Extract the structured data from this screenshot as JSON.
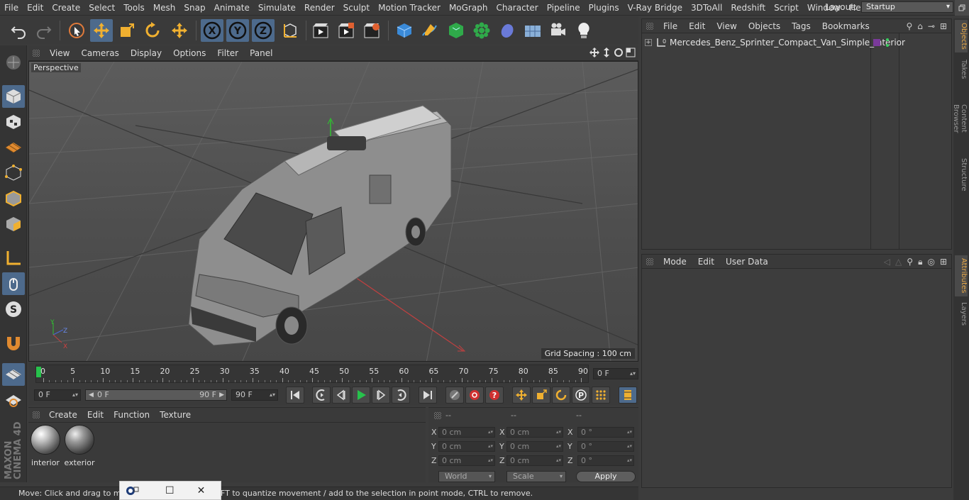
{
  "menubar": {
    "items": [
      "File",
      "Edit",
      "Create",
      "Select",
      "Tools",
      "Mesh",
      "Snap",
      "Animate",
      "Simulate",
      "Render",
      "Sculpt",
      "Motion Tracker",
      "MoGraph",
      "Character",
      "Pipeline",
      "Plugins",
      "V-Ray Bridge",
      "3DToAll",
      "Redshift",
      "Script",
      "Window",
      "Help"
    ],
    "layout_label": "Layout:",
    "layout_value": "Startup"
  },
  "viewport": {
    "menu": [
      "View",
      "Cameras",
      "Display",
      "Options",
      "Filter",
      "Panel"
    ],
    "label": "Perspective",
    "grid_spacing": "Grid Spacing : 100 cm"
  },
  "timeline": {
    "ticks": [
      "0",
      "5",
      "10",
      "15",
      "20",
      "25",
      "30",
      "35",
      "40",
      "45",
      "50",
      "55",
      "60",
      "65",
      "70",
      "75",
      "80",
      "85",
      "90"
    ],
    "current_frame": "0 F"
  },
  "anim": {
    "start": "0 F",
    "range_start": "0 F",
    "range_end": "90 F",
    "end": "90 F"
  },
  "materials": {
    "menu": [
      "Create",
      "Edit",
      "Function",
      "Texture"
    ],
    "items": [
      {
        "name": "interior"
      },
      {
        "name": "exterior"
      }
    ]
  },
  "coords": {
    "headers": [
      "--",
      "--",
      "--"
    ],
    "rows": [
      {
        "axis": "X",
        "pos": "0 cm",
        "size_axis": "X",
        "size": "0 cm",
        "rot_axis": "X",
        "rot": "0 °"
      },
      {
        "axis": "Y",
        "pos": "0 cm",
        "size_axis": "Y",
        "size": "0 cm",
        "rot_axis": "Y",
        "rot": "0 °"
      },
      {
        "axis": "Z",
        "pos": "0 cm",
        "size_axis": "Z",
        "size": "0 cm",
        "rot_axis": "Z",
        "rot": "0 °"
      }
    ],
    "mode_world": "World",
    "mode_scale": "Scale",
    "apply": "Apply"
  },
  "status": {
    "text": "Move: Click and drag to mo",
    "text2": "FT to quantize movement / add to the selection in point mode, CTRL to remove."
  },
  "objects": {
    "menu": [
      "File",
      "Edit",
      "View",
      "Objects",
      "Tags",
      "Bookmarks"
    ],
    "items": [
      {
        "name": "Mercedes_Benz_Sprinter_Compact_Van_Simple_Interior"
      }
    ]
  },
  "attributes": {
    "menu": [
      "Mode",
      "Edit",
      "User Data"
    ]
  },
  "right_tabs": [
    "Objects",
    "Takes",
    "Content Browser",
    "Structure",
    "Attributes",
    "Layers"
  ],
  "colors": {
    "accent": "#4d6a8c",
    "tab_active": "#e7a94a",
    "axis_x": "#d94040",
    "axis_y": "#40c040",
    "axis_z": "#4a6ad8",
    "play": "#27c24c"
  }
}
